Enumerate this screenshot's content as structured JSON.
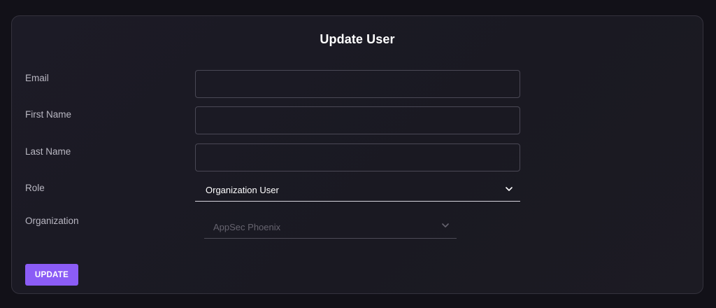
{
  "form": {
    "title": "Update User",
    "email": {
      "label": "Email",
      "value": "",
      "placeholder": ""
    },
    "first_name": {
      "label": "First Name",
      "value": "",
      "placeholder": ""
    },
    "last_name": {
      "label": "Last Name",
      "value": "",
      "placeholder": ""
    },
    "role": {
      "label": "Role",
      "selected": "Organization User"
    },
    "organization": {
      "label": "Organization",
      "selected": "AppSec Phoenix",
      "disabled": true
    },
    "submit_label": "UPDATE"
  },
  "icons": {
    "dropdown": "chevron-down-icon"
  },
  "colors": {
    "page_background": "#121118",
    "card_background": "#1c1b26",
    "accent": "#8b5cf6",
    "text_primary": "#ffffff",
    "text_label": "#b9b7c2",
    "text_disabled": "#66646f"
  }
}
